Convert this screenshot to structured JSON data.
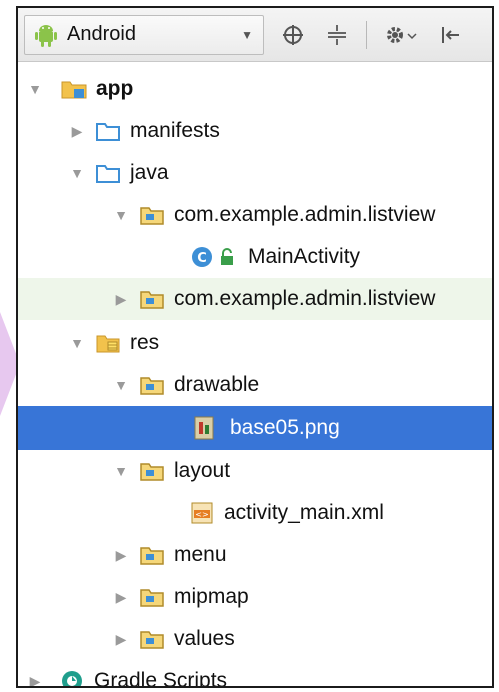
{
  "toolbar": {
    "view_selector": "Android",
    "icons": [
      "android-icon",
      "dropdown-arrow-icon",
      "sync-target-icon",
      "collapse-all-icon",
      "gear-icon",
      "hide-panel-icon"
    ]
  },
  "tree": {
    "items": [
      {
        "label": "app",
        "icon": "module-folder-icon",
        "expanded": true
      },
      {
        "label": "manifests",
        "icon": "folder-icon",
        "expanded": false
      },
      {
        "label": "java",
        "icon": "folder-icon",
        "expanded": true
      },
      {
        "label": "com.example.admin.listview",
        "icon": "package-icon",
        "expanded": true
      },
      {
        "label": "MainActivity",
        "icon": "class-icon"
      },
      {
        "label": "com.example.admin.listview",
        "icon": "package-icon",
        "expanded": false
      },
      {
        "label": "res",
        "icon": "resource-folder-icon",
        "expanded": true
      },
      {
        "label": "drawable",
        "icon": "package-icon",
        "expanded": true
      },
      {
        "label": "base05.png",
        "icon": "image-file-icon",
        "selected": true
      },
      {
        "label": "layout",
        "icon": "package-icon",
        "expanded": true
      },
      {
        "label": "activity_main.xml",
        "icon": "xml-file-icon"
      },
      {
        "label": "menu",
        "icon": "package-icon",
        "expanded": false
      },
      {
        "label": "mipmap",
        "icon": "package-icon",
        "expanded": false
      },
      {
        "label": "values",
        "icon": "package-icon",
        "expanded": false
      },
      {
        "label": "Gradle Scripts",
        "icon": "gradle-icon",
        "expanded": false
      }
    ]
  },
  "colors": {
    "selection": "#3875d7",
    "highlight_row": "#eef6ea",
    "folder_blue": "#3d8fd6",
    "android_green": "#8bc34a"
  }
}
